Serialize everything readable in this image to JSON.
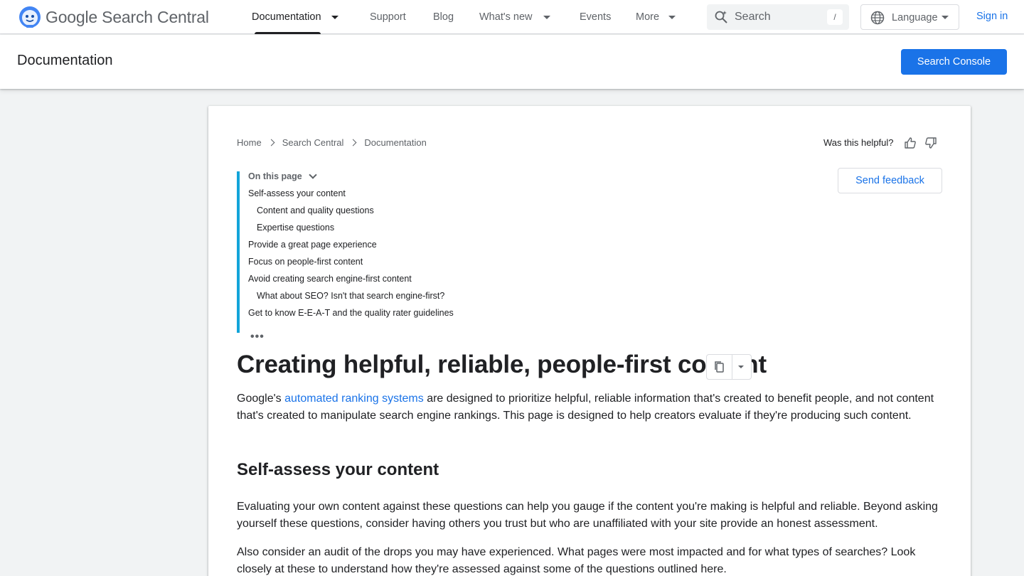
{
  "brand": {
    "name_google": "Google",
    "name_product": "Search Central"
  },
  "nav": {
    "items": [
      {
        "label": "Documentation",
        "has_dropdown": true,
        "active": true
      },
      {
        "label": "Support"
      },
      {
        "label": "Blog"
      },
      {
        "label": "What's new",
        "has_dropdown": true
      },
      {
        "label": "Events"
      },
      {
        "label": "More",
        "has_dropdown": true
      }
    ],
    "search_placeholder": "Search",
    "search_shortcut": "/",
    "language_label": "Language",
    "sign_in": "Sign in"
  },
  "subheader": {
    "title": "Documentation",
    "console_button": "Search Console"
  },
  "breadcrumb": [
    "Home",
    "Search Central",
    "Documentation"
  ],
  "feedback": {
    "helpful_question": "Was this helpful?",
    "send_feedback": "Send feedback"
  },
  "toc": {
    "heading": "On this page",
    "items": [
      {
        "label": "Self-assess your content",
        "level": 1
      },
      {
        "label": "Content and quality questions",
        "level": 2
      },
      {
        "label": "Expertise questions",
        "level": 2
      },
      {
        "label": "Provide a great page experience",
        "level": 1
      },
      {
        "label": "Focus on people-first content",
        "level": 1
      },
      {
        "label": "Avoid creating search engine-first content",
        "level": 1
      },
      {
        "label": "What about SEO? Isn't that search engine-first?",
        "level": 2
      },
      {
        "label": "Get to know E-E-A-T and the quality rater guidelines",
        "level": 1
      }
    ],
    "more": "•••"
  },
  "article": {
    "title": "Creating helpful, reliable, people-first content",
    "intro_before_link": "Google's ",
    "intro_link": "automated ranking systems",
    "intro_after_link": " are designed to prioritize helpful, reliable information that's created to benefit people, and not content that's created to manipulate search engine rankings. This page is designed to help creators evaluate if they're producing such content.",
    "section_heading": "Self-assess your content",
    "section_para1": "Evaluating your own content against these questions can help you gauge if the content you're making is helpful and reliable. Beyond asking yourself these questions, consider having others you trust but who are unaffiliated with your site provide an honest assessment.",
    "section_para2": "Also consider an audit of the drops you may have experienced. What pages were most impacted and for what types of searches? Look closely at these to understand how they're assessed against some of the questions outlined here."
  },
  "colors": {
    "accent": "#1a73e8",
    "toc_border": "#12a4d9"
  }
}
